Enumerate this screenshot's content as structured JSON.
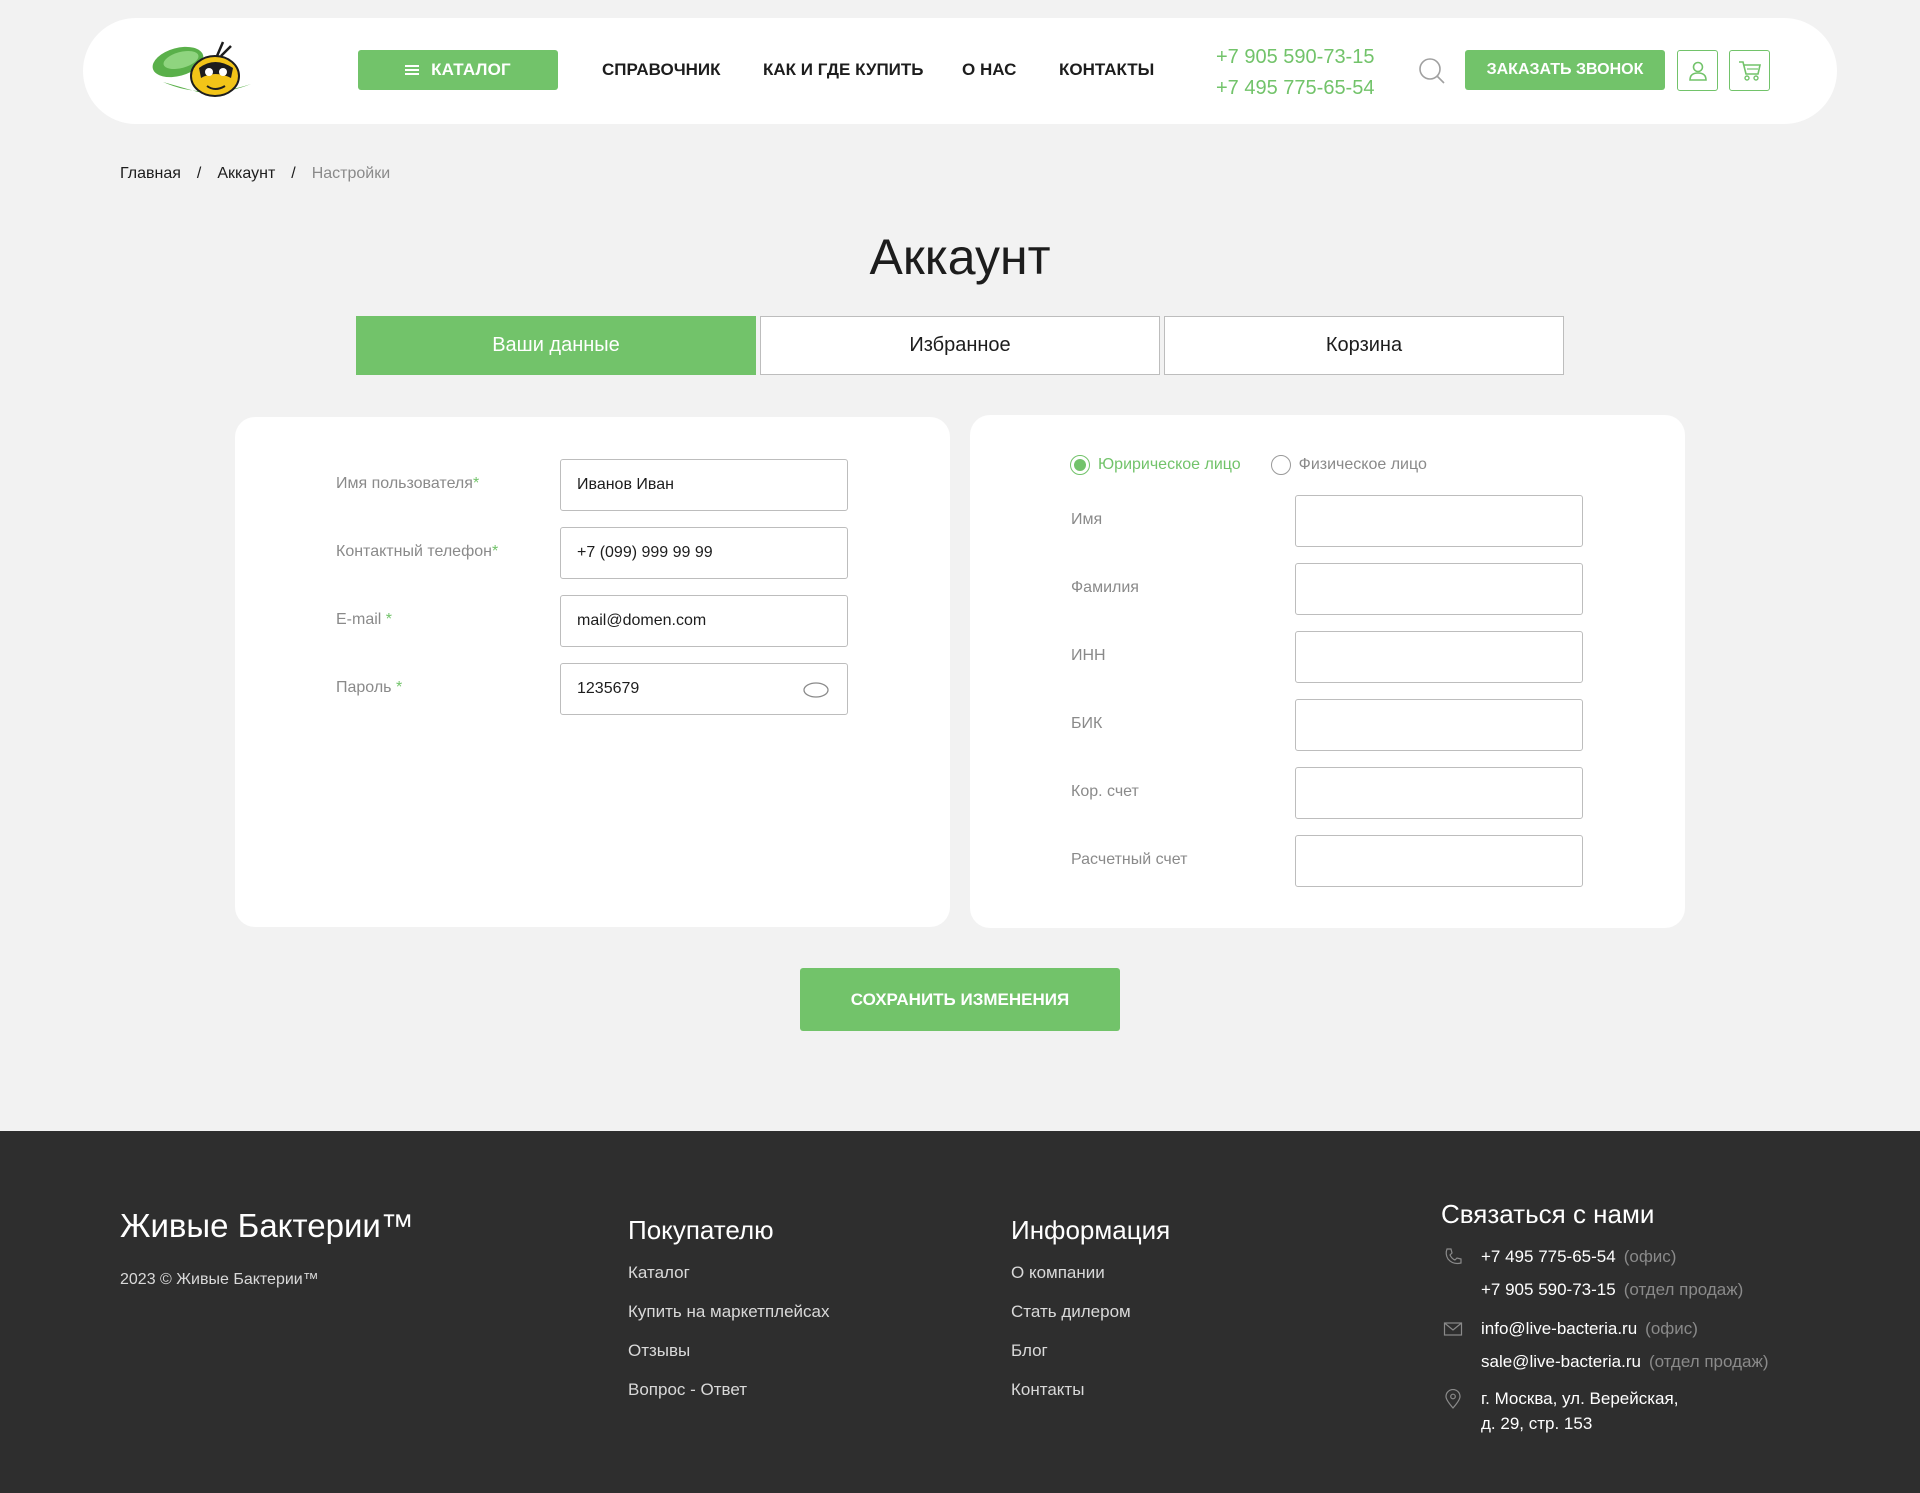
{
  "header": {
    "catalog_label": "КАТАЛОГ",
    "nav": [
      "СПРАВОЧНИК",
      "КАК И ГДЕ КУПИТЬ",
      "О НАС",
      "КОНТАКТЫ"
    ],
    "phones": [
      "+7 905 590-73-15",
      "+7 495 775-65-54"
    ],
    "callback_label": "ЗАКАЗАТЬ ЗВОНОК"
  },
  "breadcrumb": [
    "Главная",
    "Аккаунт",
    "Настройки"
  ],
  "page_title": "Аккаунт",
  "tabs": [
    {
      "label": "Ваши данные",
      "active": true
    },
    {
      "label": "Избранное",
      "active": false
    },
    {
      "label": "Корзина",
      "active": false
    }
  ],
  "user_form": {
    "username": {
      "label": "Имя пользователя",
      "value": "Иванов Иван"
    },
    "phone": {
      "label": "Контактный телефон",
      "value": "+7 (099) 999 99 99"
    },
    "email": {
      "label": "E-mail ",
      "value": "mail@domen.com"
    },
    "password": {
      "label": "Пароль ",
      "value": "1235679"
    },
    "required_mark": "*"
  },
  "entity_form": {
    "radio_options": [
      "Юририческое лицо",
      "Физическое лицо"
    ],
    "selected": "Юририческое лицо",
    "fields": [
      "Имя",
      "Фамилия",
      "ИНН",
      "БИК",
      "Кор. счет",
      "Расчетный счет"
    ]
  },
  "save_label": "СОХРАНИТЬ ИЗМЕНЕНИЯ",
  "footer": {
    "brand": "Живые Бактерии™",
    "copyright": "2023 © Живые Бактерии™",
    "col_buyer": {
      "title": "Покупателю",
      "links": [
        "Каталог",
        "Купить на маркетплейсах",
        "Отзывы",
        "Вопрос - Ответ"
      ]
    },
    "col_info": {
      "title": "Информация",
      "links": [
        "О компании",
        "Стать дилером",
        "Блог",
        "Контакты"
      ]
    },
    "contacts": {
      "title": "Связаться с нами",
      "phone1": "+7 495 775-65-54",
      "phone1_note": "(офис)",
      "phone2": "+7 905 590-73-15",
      "phone2_note": "(отдел продаж)",
      "email1": "info@live-bacteria.ru",
      "email1_note": "(офис)",
      "email2": "sale@live-bacteria.ru",
      "email2_note": "(отдел продаж)",
      "address1": "г. Москва, ул. Верейская,",
      "address2": "д. 29, стр. 153"
    }
  },
  "colors": {
    "accent": "#72c36a",
    "footer_bg": "#2e2e2e",
    "page_bg": "#f2f2f2"
  }
}
